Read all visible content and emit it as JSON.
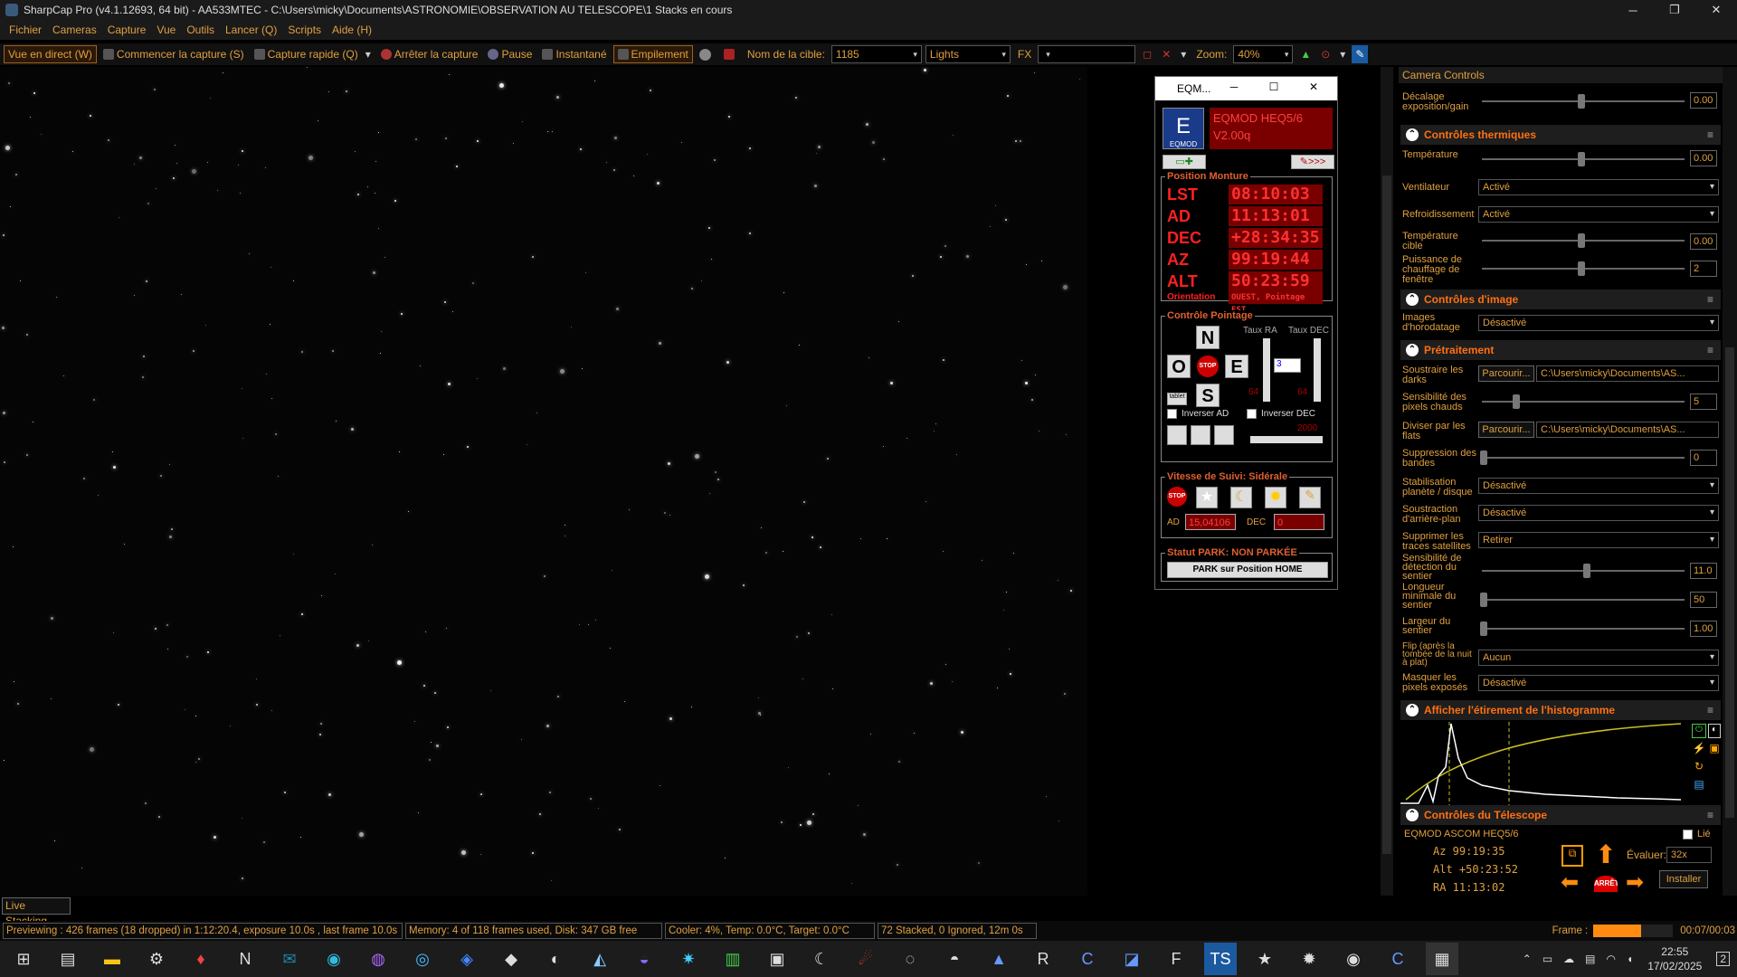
{
  "window": {
    "title": "SharpCap Pro (v4.1.12693, 64 bit) - AA533MTEC - C:\\Users\\micky\\Documents\\ASTRONOMIE\\OBSERVATION AU TELESCOPE\\1 Stacks en cours"
  },
  "menu": [
    "Fichier",
    "Cameras",
    "Capture",
    "Vue",
    "Outils",
    "Lancer (Q)",
    "Scripts",
    "Aide (H)"
  ],
  "toolbar": {
    "live": "Vue en direct (W)",
    "start": "Commencer la capture (S)",
    "quick": "Capture rapide (Q)",
    "stop": "Arrêter la capture",
    "pause": "Pause",
    "snapshot": "Instantané",
    "stack": "Empilement",
    "target_label": "Nom de la cible:",
    "target_value": "1185",
    "frame_type": "Lights",
    "fx_label": "FX",
    "fx_value": "",
    "zoom_label": "Zoom:",
    "zoom_value": "40%"
  },
  "eqmod": {
    "title": "EQM...",
    "logo": "E",
    "logo_sub": "EQMOD",
    "mount_name": "EQMOD HEQ5/6",
    "version": "V2.00q",
    "position_title": "Position Monture",
    "lst_k": "LST",
    "lst_v": "08:10:03",
    "ad_k": "AD",
    "ad_v": "11:13:01",
    "dec_k": "DEC",
    "dec_v": "+28:34:35",
    "az_k": "AZ",
    "az_v": "99:19:44",
    "alt_k": "ALT",
    "alt_v": "50:23:59",
    "orientation_k": "Orientation",
    "orientation_v": "OUEST, Pointage EST",
    "pointing_title": "Contrôle Pointage",
    "rate_ra": "Taux RA",
    "rate_dec": "Taux DEC",
    "n": "N",
    "o": "O",
    "e": "E",
    "s": "S",
    "stop": "STOP",
    "tablet": "tablet",
    "rate_sel": "3",
    "ra_val": "64",
    "dec_val": "64",
    "inv_ad": "Inverser AD",
    "inv_dec": "Inverser DEC",
    "slider_val": "2000",
    "track_title": "Vitesse de Suivi: Sidérale",
    "ad_label": "AD",
    "ad_rate": "15,04106",
    "dec_label": "DEC",
    "dec_rate": "0",
    "park_status": "Statut PARK: NON PARKÉE",
    "park_btn": "PARK sur Position HOME"
  },
  "panel": {
    "header": "Camera Controls",
    "offset_label": "Décalage exposition/gain",
    "offset_val": "0.00",
    "thermal": "Contrôles thermiques",
    "temp_label": "Température",
    "temp_val": "0.00",
    "fan_label": "Ventilateur",
    "fan_val": "Activé",
    "cool_label": "Refroidissement",
    "cool_val": "Activé",
    "target_temp_label": "Température cible",
    "target_temp_val": "0.00",
    "heater_label": "Puissance de chauffage de fenêtre",
    "heater_val": "2",
    "image_ctrl": "Contrôles d'image",
    "timestamp_label": "Images d'horodatage",
    "timestamp_val": "Désactivé",
    "preproc": "Prétraitement",
    "darks_label": "Soustraire les darks",
    "browse": "Parcourir...",
    "darks_path": "C:\\Users\\micky\\Documents\\AS...",
    "hot_label": "Sensibilité des pixels chauds",
    "hot_val": "5",
    "flats_label": "Diviser par les flats",
    "flats_path": "C:\\Users\\micky\\Documents\\AS...",
    "band_label": "Suppression des bandes",
    "band_val": "0",
    "stab_label": "Stabilisation planète / disque",
    "stab_val": "Désactivé",
    "bg_label": "Soustraction d'arrière-plan",
    "bg_val": "Désactivé",
    "sat_label": "Supprimer les traces satellites",
    "sat_val": "Retirer",
    "det_label": "Sensibilité de détection du sentier",
    "det_val": "11.0",
    "minlen_label": "Longueur minimale du sentier",
    "minlen_val": "50",
    "width_label": "Largeur du sentier",
    "width_val": "1.00",
    "flip_label": "Flip (après la tombée de la nuit à plat)",
    "flip_val": "Aucun",
    "mask_label": "Masquer les pixels exposés",
    "mask_val": "Désactivé",
    "histo": "Afficher l'étirement de l'histogramme",
    "tel": "Contrôles du Télescope",
    "tel_name": "EQMOD ASCOM HEQ5/6",
    "linked": "Lié",
    "tel_az": "Az    99:19:35",
    "tel_alt": "Alt  +50:23:52",
    "tel_ra": "RA    11:13:02",
    "eval_label": "Évaluer:",
    "eval_val": "32x",
    "install": "Installer",
    "stop_btn": "ARRÊTE"
  },
  "live_tab": "Live Stacking",
  "status": {
    "preview": "Previewing : 426 frames (18 dropped) in 1:12:20.4, exposure 10.0s , last frame 10.0s",
    "memory": "Memory: 4 of 118 frames used, Disk: 347 GB free",
    "cooler": "Cooler: 4%, Temp: 0.0°C, Target: 0.0°C",
    "stacked": "72 Stacked, 0 Ignored, 12m 0s",
    "frame_label": "Frame :",
    "frame_progress": 0.6,
    "frame_time": "00:07/00:03"
  },
  "taskbar": {
    "time": "22:55",
    "date": "17/02/2025",
    "notif": "2"
  },
  "colors": {
    "accent": "#e0a040",
    "header": "#ff7010",
    "eq_red": "#ff2020"
  }
}
